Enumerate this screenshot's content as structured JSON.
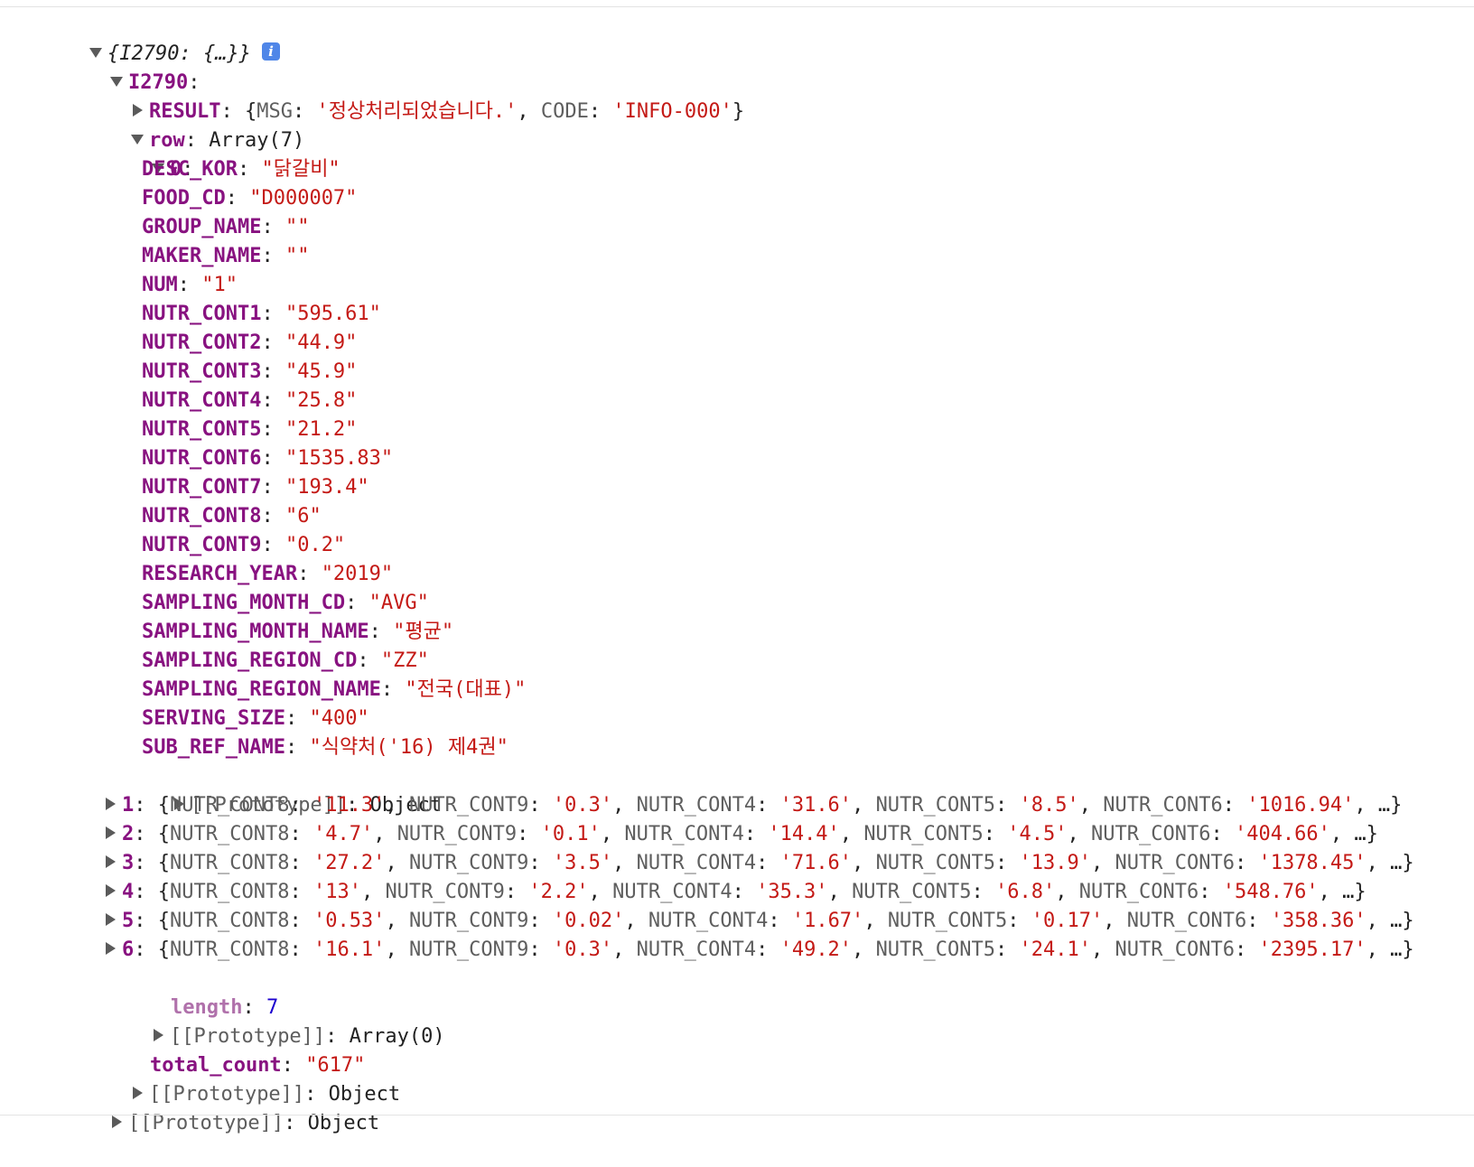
{
  "root": {
    "summary": "{I2790: {…}}",
    "info_glyph": "i"
  },
  "obj": {
    "key": "I2790",
    "result": {
      "key": "RESULT",
      "preview_open": "{",
      "msg_key": "MSG",
      "msg_val": "'정상처리되었습니다.'",
      "code_key": "CODE",
      "code_val": "'INFO-000'",
      "preview_close": "}"
    },
    "row": {
      "key": "row",
      "type_label": "Array(7)",
      "item0": {
        "index": "0",
        "fields": [
          {
            "key": "DESC_KOR",
            "value": "\"닭갈비\""
          },
          {
            "key": "FOOD_CD",
            "value": "\"D000007\""
          },
          {
            "key": "GROUP_NAME",
            "value": "\"\""
          },
          {
            "key": "MAKER_NAME",
            "value": "\"\""
          },
          {
            "key": "NUM",
            "value": "\"1\""
          },
          {
            "key": "NUTR_CONT1",
            "value": "\"595.61\""
          },
          {
            "key": "NUTR_CONT2",
            "value": "\"44.9\""
          },
          {
            "key": "NUTR_CONT3",
            "value": "\"45.9\""
          },
          {
            "key": "NUTR_CONT4",
            "value": "\"25.8\""
          },
          {
            "key": "NUTR_CONT5",
            "value": "\"21.2\""
          },
          {
            "key": "NUTR_CONT6",
            "value": "\"1535.83\""
          },
          {
            "key": "NUTR_CONT7",
            "value": "\"193.4\""
          },
          {
            "key": "NUTR_CONT8",
            "value": "\"6\""
          },
          {
            "key": "NUTR_CONT9",
            "value": "\"0.2\""
          },
          {
            "key": "RESEARCH_YEAR",
            "value": "\"2019\""
          },
          {
            "key": "SAMPLING_MONTH_CD",
            "value": "\"AVG\""
          },
          {
            "key": "SAMPLING_MONTH_NAME",
            "value": "\"평균\""
          },
          {
            "key": "SAMPLING_REGION_CD",
            "value": "\"ZZ\""
          },
          {
            "key": "SAMPLING_REGION_NAME",
            "value": "\"전국(대표)\""
          },
          {
            "key": "SERVING_SIZE",
            "value": "\"400\""
          },
          {
            "key": "SUB_REF_NAME",
            "value": "\"식약처('16) 제4권\""
          }
        ],
        "prototype_key": "[[Prototype]]",
        "prototype_val": "Object"
      },
      "items": [
        {
          "index": "1",
          "v8": "'11.3'",
          "v9": "'0.3'",
          "v4": "'31.6'",
          "v5": "'8.5'",
          "v6": "'1016.94'"
        },
        {
          "index": "2",
          "v8": "'4.7'",
          "v9": "'0.1'",
          "v4": "'14.4'",
          "v5": "'4.5'",
          "v6": "'404.66'"
        },
        {
          "index": "3",
          "v8": "'27.2'",
          "v9": "'3.5'",
          "v4": "'71.6'",
          "v5": "'13.9'",
          "v6": "'1378.45'"
        },
        {
          "index": "4",
          "v8": "'13'",
          "v9": "'2.2'",
          "v4": "'35.3'",
          "v5": "'6.8'",
          "v6": "'548.76'"
        },
        {
          "index": "5",
          "v8": "'0.53'",
          "v9": "'0.02'",
          "v4": "'1.67'",
          "v5": "'0.17'",
          "v6": "'358.36'"
        },
        {
          "index": "6",
          "v8": "'16.1'",
          "v9": "'0.3'",
          "v4": "'49.2'",
          "v5": "'24.1'",
          "v6": "'2395.17'"
        }
      ],
      "preview_keys": {
        "k8": "NUTR_CONT8",
        "k9": "NUTR_CONT9",
        "k4": "NUTR_CONT4",
        "k5": "NUTR_CONT5",
        "k6": "NUTR_CONT6"
      },
      "ellipsis": "…",
      "length_key": "length",
      "length_val": "7",
      "prototype_key": "[[Prototype]]",
      "prototype_val": "Array(0)"
    },
    "total_count": {
      "key": "total_count",
      "value": "\"617\""
    },
    "prototype_key": "[[Prototype]]",
    "prototype_val": "Object"
  },
  "root_prototype": {
    "key": "[[Prototype]]",
    "value": "Object"
  },
  "colors": {
    "key": "#881280",
    "string": "#c41a16",
    "number": "#1c00cf",
    "info_badge": "#4f86e8"
  }
}
